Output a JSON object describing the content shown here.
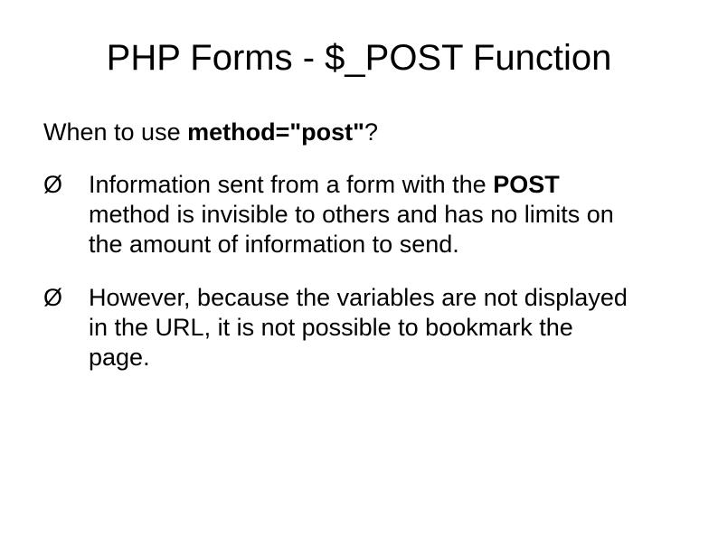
{
  "slide": {
    "title": "PHP Forms - $_POST Function",
    "subtitle_prefix": "When to use ",
    "subtitle_bold": "method=\"post\"",
    "subtitle_suffix": "?",
    "bullets": [
      {
        "marker": "Ø",
        "text_before": "Information sent from a form with the ",
        "text_bold": "POST",
        "text_after": " method is invisible to others and has no limits on the amount of information to send."
      },
      {
        "marker": "Ø",
        "text_before": "However, because the variables are not displayed in the URL, it is not possible to bookmark the page.",
        "text_bold": "",
        "text_after": ""
      }
    ]
  }
}
